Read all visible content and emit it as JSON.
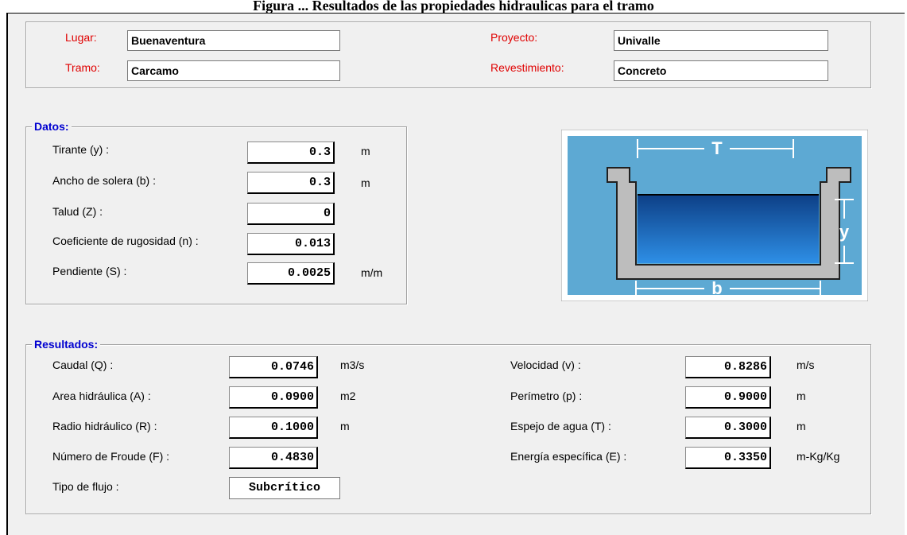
{
  "caption": "Figura ... Resultados de las propiedades hidraulicas para el tramo",
  "header": {
    "lugar_label": "Lugar:",
    "lugar_value": "Buenaventura",
    "tramo_label": "Tramo:",
    "tramo_value": "Carcamo",
    "proyecto_label": "Proyecto:",
    "proyecto_value": "Univalle",
    "revestimiento_label": "Revestimiento:",
    "revestimiento_value": "Concreto"
  },
  "datos": {
    "title": "Datos:",
    "rows": [
      {
        "label": "Tirante (y) :",
        "value": "0.3",
        "unit": "m"
      },
      {
        "label": "Ancho de solera (b) :",
        "value": "0.3",
        "unit": "m"
      },
      {
        "label": "Talud  (Z) :",
        "value": "0",
        "unit": ""
      },
      {
        "label": "Coeficiente de rugosidad (n) :",
        "value": "0.013",
        "unit": ""
      },
      {
        "label": "Pendiente (S) :",
        "value": "0.0025",
        "unit": "m/m"
      }
    ]
  },
  "diagram": {
    "top_label": "T",
    "side_label": "y",
    "bottom_label": "b",
    "colors": {
      "bg": "#5da9d3",
      "water": "#1e7fd6",
      "wall": "#bdbdbd"
    }
  },
  "resultados": {
    "title": "Resultados:",
    "left": [
      {
        "label": "Caudal (Q) :",
        "value": "0.0746",
        "unit": "m3/s"
      },
      {
        "label": "Area hidráulica (A) :",
        "value": "0.0900",
        "unit": "m2"
      },
      {
        "label": "Radio hidráulico (R) :",
        "value": "0.1000",
        "unit": "m"
      },
      {
        "label": "Número de Froude (F) :",
        "value": "0.4830",
        "unit": ""
      }
    ],
    "tipo_label": "Tipo de flujo :",
    "tipo_value": "Subcrítico",
    "right": [
      {
        "label": "Velocidad (v) :",
        "value": "0.8286",
        "unit": "m/s"
      },
      {
        "label": "Perímetro (p) :",
        "value": "0.9000",
        "unit": "m"
      },
      {
        "label": "Espejo de agua (T) :",
        "value": "0.3000",
        "unit": "m"
      },
      {
        "label": "Energía específica (E) :",
        "value": "0.3350",
        "unit": "m-Kg/Kg"
      }
    ]
  }
}
